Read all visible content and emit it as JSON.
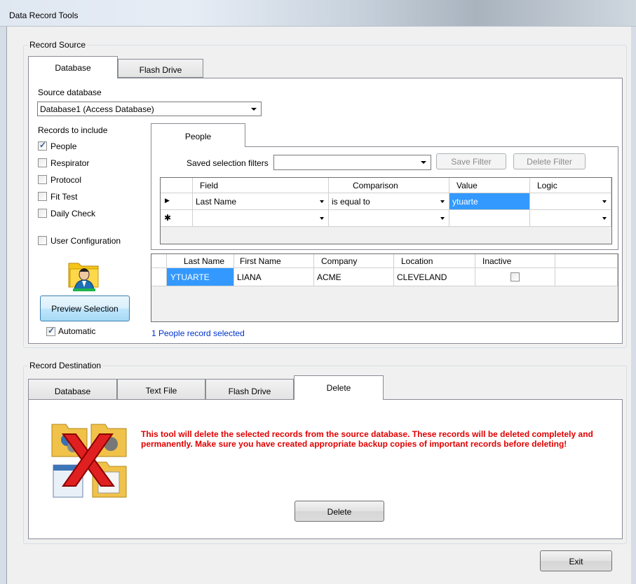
{
  "window": {
    "title": "Data Record Tools"
  },
  "record_source": {
    "label": "Record Source",
    "tabs": [
      {
        "label": "Database"
      },
      {
        "label": "Flash Drive"
      }
    ],
    "source_db_label": "Source database",
    "source_db_value": "Database1 (Access Database)",
    "records_label": "Records to include",
    "checkboxes": [
      {
        "label": "People",
        "checked": true
      },
      {
        "label": "Respirator",
        "checked": false
      },
      {
        "label": "Protocol",
        "checked": false
      },
      {
        "label": "Fit Test",
        "checked": false
      },
      {
        "label": "Daily Check",
        "checked": false
      }
    ],
    "user_config": {
      "label": "User Configuration",
      "checked": false
    },
    "preview_button": "Preview Selection",
    "automatic": {
      "label": "Automatic",
      "checked": true
    },
    "people_tab": "People",
    "filters_label": "Saved selection filters",
    "filters_value": "",
    "save_filter": "Save Filter",
    "delete_filter": "Delete Filter",
    "filter_grid": {
      "headers": [
        "Field",
        "Comparison",
        "Value",
        "Logic"
      ],
      "rows": [
        {
          "indicator": "▶",
          "field": "Last Name",
          "comparison": "is equal to",
          "value": "ytuarte",
          "logic": ""
        },
        {
          "indicator": "✱",
          "field": "",
          "comparison": "",
          "value": "",
          "logic": ""
        }
      ]
    },
    "result_grid": {
      "headers": [
        "Last Name",
        "First Name",
        "Company",
        "Location",
        "Inactive"
      ],
      "rows": [
        {
          "last": "YTUARTE",
          "first": "LIANA",
          "company": "ACME",
          "location": "CLEVELAND",
          "inactive": false
        }
      ]
    },
    "status": "1 People record selected"
  },
  "record_destination": {
    "label": "Record Destination",
    "tabs": [
      {
        "label": "Database"
      },
      {
        "label": "Text File"
      },
      {
        "label": "Flash Drive"
      },
      {
        "label": "Delete"
      }
    ],
    "warning": "This tool will delete the selected records from the source database.  These records will be deleted completely and permanently.  Make sure you have created appropriate backup copies of important records before deleting!",
    "delete_button": "Delete"
  },
  "exit_button": "Exit"
}
